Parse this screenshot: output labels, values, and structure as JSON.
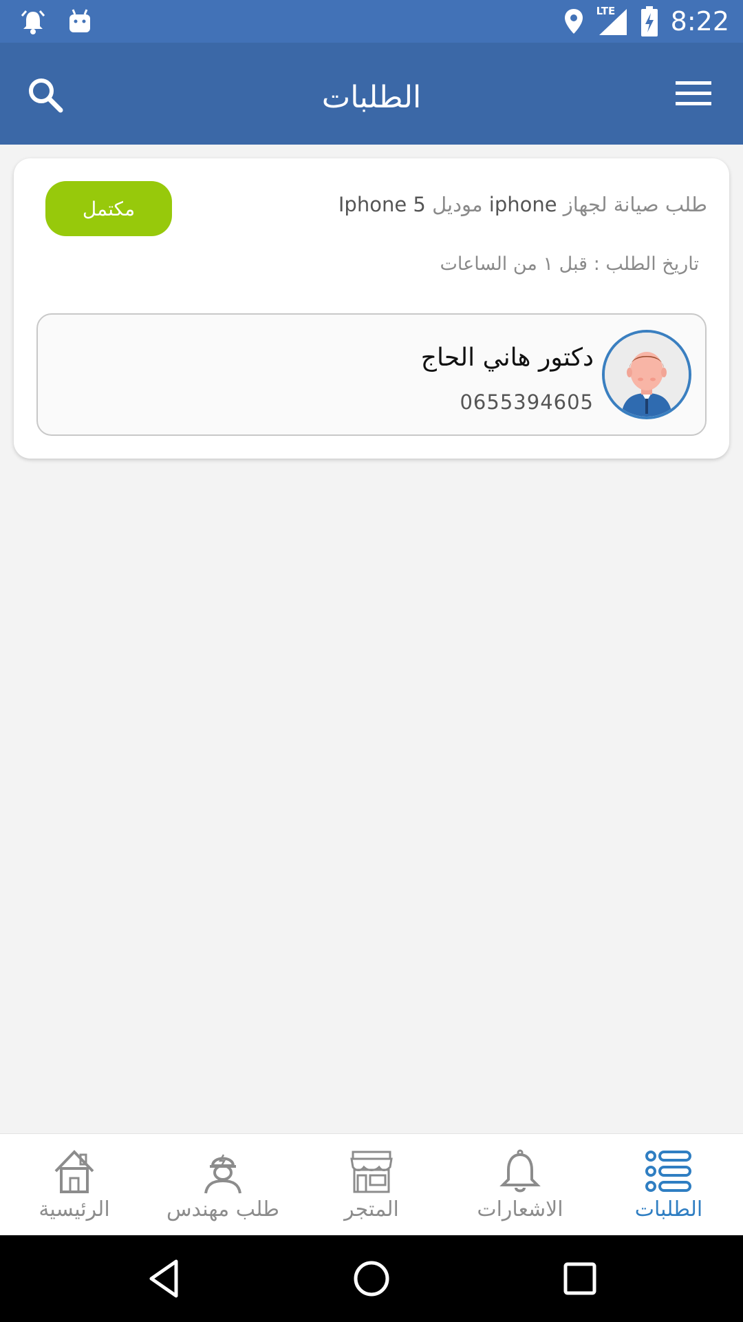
{
  "status_bar": {
    "time": "8:22",
    "network": "LTE",
    "icons": [
      "alarm-icon",
      "android-icon",
      "location-icon",
      "signal-icon",
      "battery-charging-icon"
    ]
  },
  "app_bar": {
    "title": "الطلبات",
    "search_icon": "search-icon",
    "menu_icon": "menu-icon"
  },
  "order": {
    "status": "مكتمل",
    "status_color": "#97c90b",
    "request_prefix": "طلب صيانة لجهاز",
    "device": "iphone",
    "model_prefix": "موديل",
    "model": "Iphone 5",
    "date_label": "تاريخ الطلب :",
    "date_value": "قبل ١ من الساعات",
    "engineer": {
      "name": "دكتور هاني الحاج",
      "phone": "0655394605"
    }
  },
  "bottom_nav": {
    "items": [
      {
        "label": "الرئيسية",
        "icon": "home-icon",
        "active": false
      },
      {
        "label": "طلب مهندس",
        "icon": "engineer-icon",
        "active": false
      },
      {
        "label": "المتجر",
        "icon": "store-icon",
        "active": false
      },
      {
        "label": "الاشعارات",
        "icon": "bell-icon",
        "active": false
      },
      {
        "label": "الطلبات",
        "icon": "list-icon",
        "active": true
      }
    ],
    "active_color": "#2f7ec2"
  },
  "colors": {
    "status_bar": "#4272b7",
    "app_bar": "#3b68a7",
    "background": "#f3f3f3"
  }
}
